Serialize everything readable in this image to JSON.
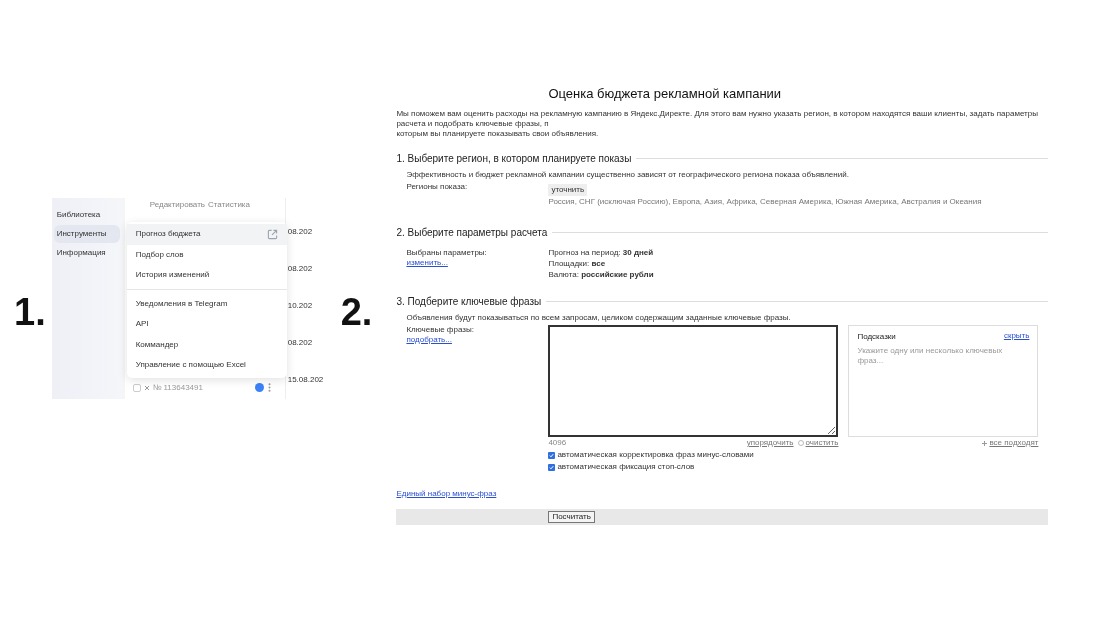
{
  "screenshot_1": {
    "number": "1.",
    "sidebar": {
      "items": [
        {
          "label": "Библиотека",
          "selected": false
        },
        {
          "label": "Инструменты",
          "selected": true
        },
        {
          "label": "Информация",
          "selected": false
        }
      ]
    },
    "table": {
      "links": [
        "Редактировать",
        "Статистика"
      ],
      "dates": [
        "08.202",
        "08.202",
        "10.202",
        "08.202",
        "15.08.202"
      ],
      "last_row_id": "№ 113643491",
      "last_row_checked": false
    },
    "menu": {
      "groups": [
        [
          {
            "label": "Прогноз бюджета",
            "selected": true,
            "external_link": true
          },
          {
            "label": "Подбор слов",
            "selected": false,
            "external_link": false
          },
          {
            "label": "История изменений",
            "selected": false,
            "external_link": false
          }
        ],
        [
          {
            "label": "Уведомления в Telegram",
            "selected": false,
            "external_link": false
          },
          {
            "label": "API",
            "selected": false,
            "external_link": false
          },
          {
            "label": "Коммандер",
            "selected": false,
            "external_link": false
          },
          {
            "label": "Управление с помощью Excel",
            "selected": false,
            "external_link": false
          }
        ]
      ]
    }
  },
  "screenshot_2": {
    "number": "2.",
    "title": "Оценка бюджета рекламной кампании",
    "intro": [
      "Мы поможем вам оценить расходы на рекламную кампанию в Яндекс.Директе. Для этого вам нужно указать регион, в котором находятся ваши клиенты, задать параметры расчета и подобрать ключевые фразы, п",
      "которым вы планируете показывать свои объявления."
    ],
    "region": {
      "heading": "1. Выберите регион, в котором планируете показы",
      "note": "Эффективность и бюджет рекламной кампании существенно зависят от географического региона показа объявлений.",
      "label": "Регионы показа:",
      "button": "уточнить",
      "regions": "Россия, СНГ (исключая Россию), Европа, Азия, Африка, Северная Америка, Южная Америка, Австралия и Океания"
    },
    "params": {
      "heading": "2. Выберите параметры расчета",
      "label": "Выбраны параметры:",
      "link": "изменить...",
      "values": [
        {
          "label": "Прогноз на период:",
          "value": "30 дней"
        },
        {
          "label": "Площадки:",
          "value": "все"
        },
        {
          "label": "Валюта:",
          "value": "российские рубли"
        }
      ]
    },
    "keywords": {
      "heading": "3. Подберите ключевые фразы",
      "note": "Объявления будут показываться по всем запросам, целиком содержащим заданные ключевые фразы.",
      "label": "Ключевые фразы:",
      "link": "подобрать...",
      "counter": "4096",
      "sort_link": "упорядочить",
      "clear_link": "очистить",
      "checkboxes": [
        {
          "label": "автоматическая корректировка фраз минус-словами",
          "checked": true
        },
        {
          "label": "автоматическая фиксация стоп-слов",
          "checked": true
        }
      ],
      "hints": {
        "title": "Подсказки",
        "hide_link": "скрыть",
        "hint_text": "Укажите одну или несколько ключевых фраз...",
        "add_all": "все подходят"
      }
    },
    "minus_link": "Единый набор минус-фраз",
    "submit": "Посчитать"
  }
}
